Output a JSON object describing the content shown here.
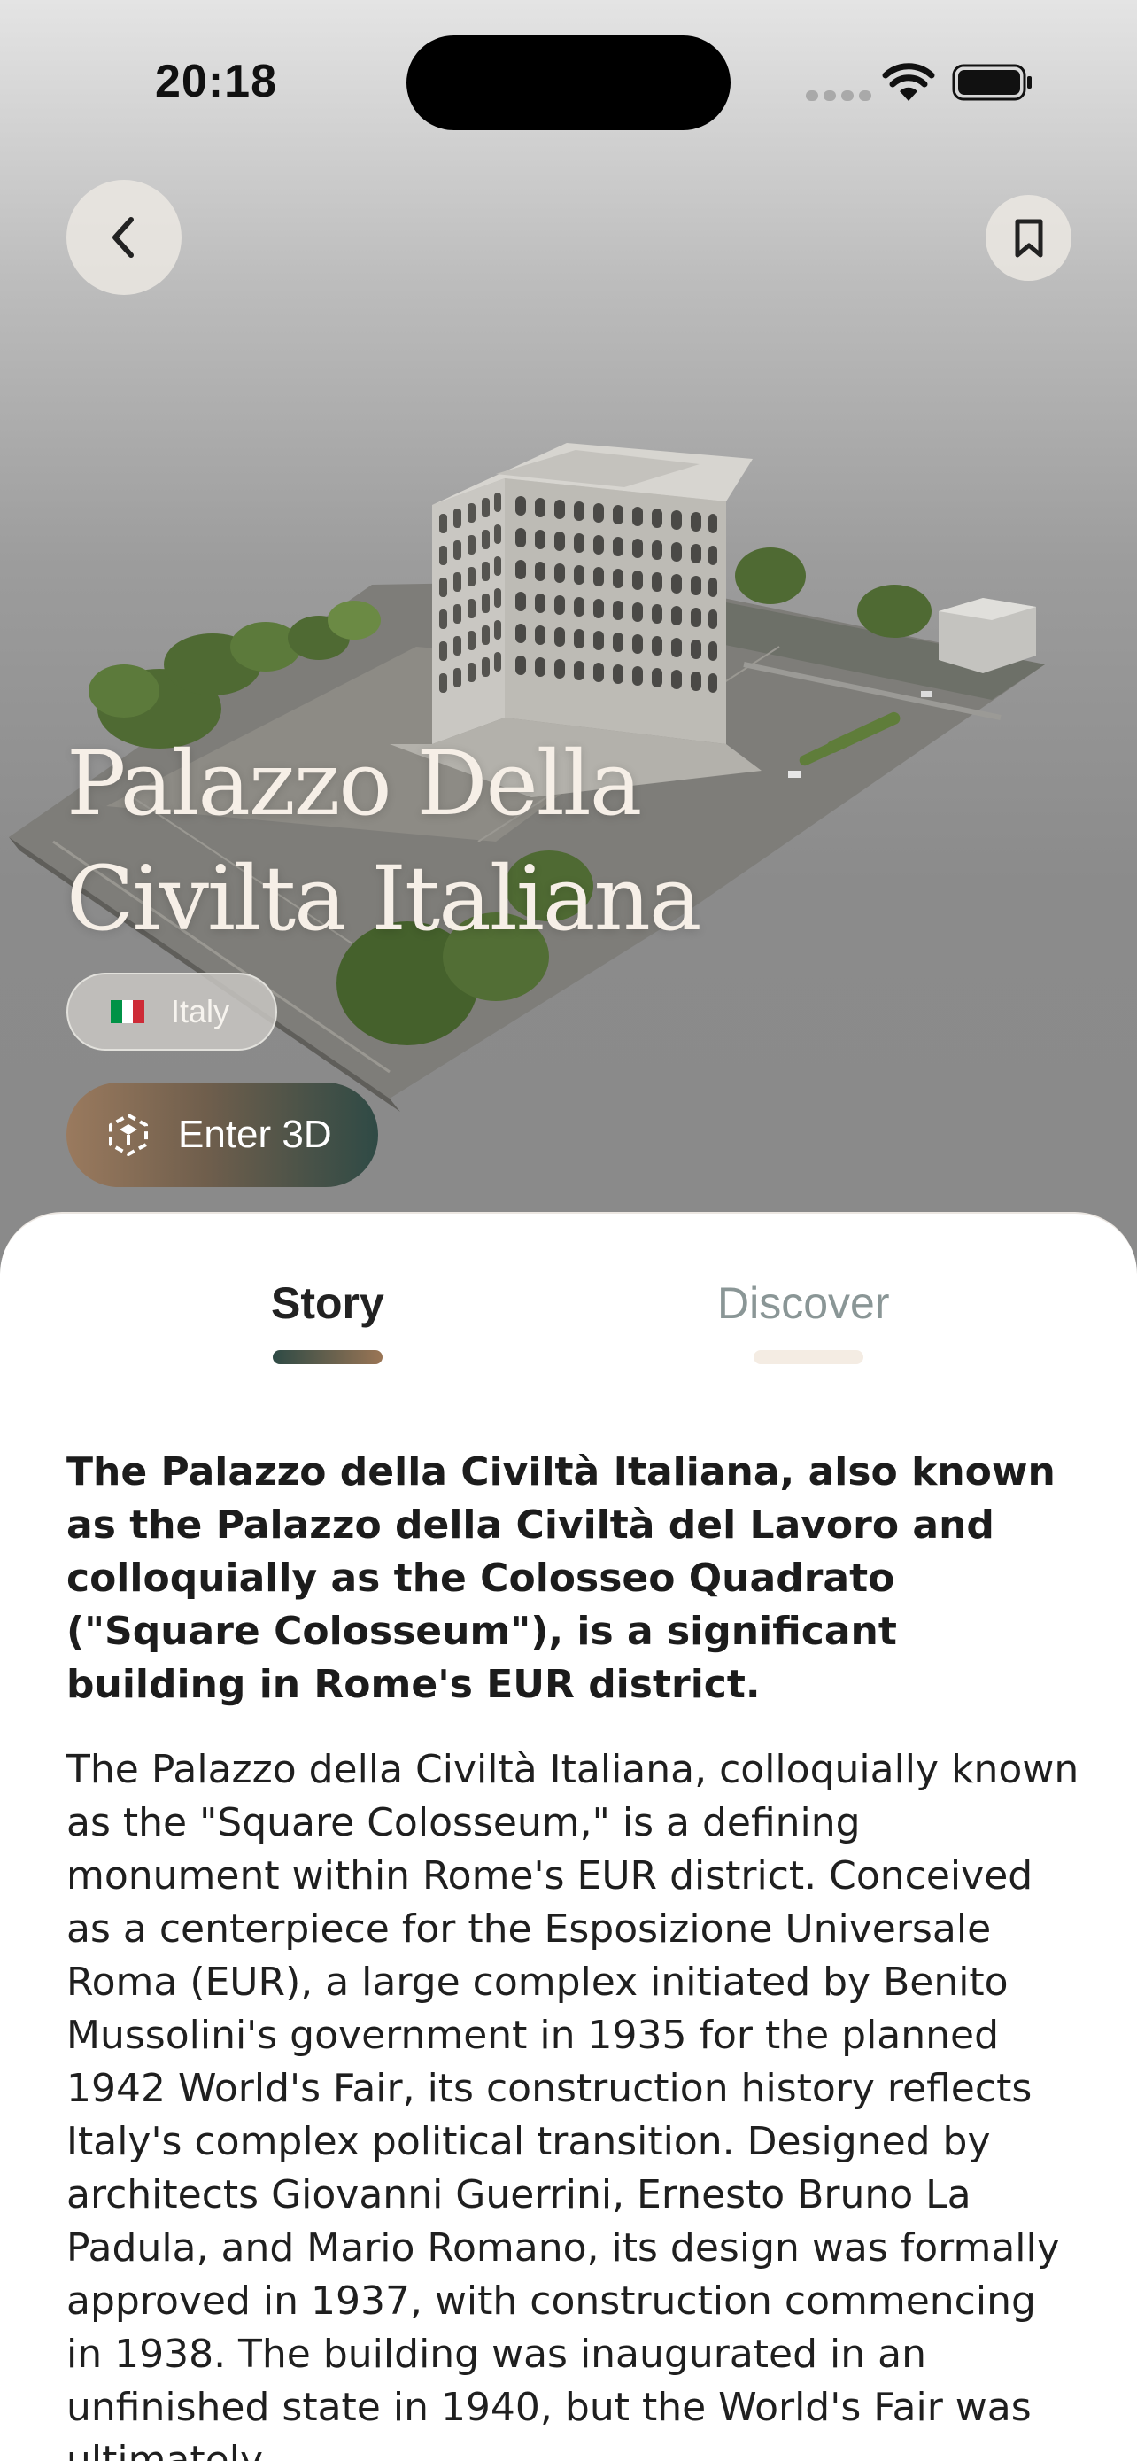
{
  "status_bar": {
    "time": "20:18"
  },
  "hero": {
    "title": "Palazzo Della Civilta Italiana",
    "country": "Italy",
    "flag_colors": [
      "#009246",
      "#ffffff",
      "#ce2b37"
    ],
    "enter_button_label": "Enter 3D"
  },
  "icons": {
    "back": "chevron-left-icon",
    "bookmark": "bookmark-icon",
    "enter3d": "cube-icon"
  },
  "tabs": [
    {
      "label": "Story",
      "active": true
    },
    {
      "label": "Discover",
      "active": false
    }
  ],
  "content": {
    "lead": "The Palazzo della Civiltà Italiana, also known as the Palazzo della Civiltà del Lavoro and colloquially as the Colosseo Quadrato (\"Square Colosseum\"), is a significant building in Rome's EUR district.",
    "body": "The Palazzo della Civiltà Italiana, colloquially known as the \"Square Colosseum,\" is a defining monument within Rome's EUR district. Conceived as a centerpiece for the Esposizione Universale Roma (EUR), a large complex initiated by Benito Mussolini's government in 1935 for the planned 1942 World's Fair, its construction history reflects Italy's complex political transition. Designed by architects Giovanni Guerrini, Ernesto Bruno La Padula, and Mario Romano, its design was formally approved in 1937, with construction commencing in 1938. The building was inaugurated in an unfinished state in 1940, but the World's Fair was ultimately"
  },
  "colors": {
    "accent_green": "#2f4a45",
    "accent_bronze": "#9a7a5e",
    "title_cream": "#f6efe7"
  }
}
